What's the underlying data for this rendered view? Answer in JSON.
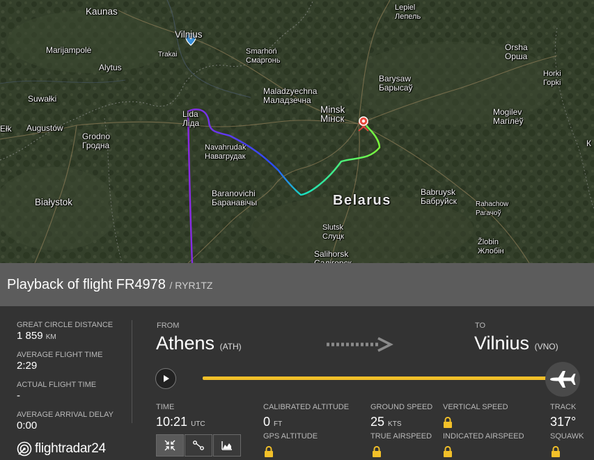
{
  "map": {
    "cities": [
      {
        "id": "kaunas",
        "label": "Kaunas"
      },
      {
        "id": "vilnius",
        "label": "Vilnius"
      },
      {
        "id": "trakai",
        "label": "Trakai"
      },
      {
        "id": "marijampole",
        "label": "Marijampolė"
      },
      {
        "id": "alytus",
        "label": "Alytus"
      },
      {
        "id": "smarhon",
        "label": "Smarhoń\nСмаргонь"
      },
      {
        "id": "lepiel",
        "label": "Lepiel\nЛепель"
      },
      {
        "id": "orsha",
        "label": "Orsha\nОрша"
      },
      {
        "id": "barysaw",
        "label": "Barysaw\nБарысаў"
      },
      {
        "id": "horki",
        "label": "Horki\nГорki"
      },
      {
        "id": "maladzyechna",
        "label": "Maladzyechna\nМаладзечна"
      },
      {
        "id": "minsk",
        "label": "Minsk\nМінск"
      },
      {
        "id": "mogilev",
        "label": "Mogilev\nМагілёў"
      },
      {
        "id": "suwalki",
        "label": "Suwałki"
      },
      {
        "id": "elk",
        "label": "Ełk"
      },
      {
        "id": "augustow",
        "label": "Augustów"
      },
      {
        "id": "grodno",
        "label": "Grodno\nГродна"
      },
      {
        "id": "lida",
        "label": "Lida\nЛіда"
      },
      {
        "id": "navahrudak",
        "label": "Navahrudak\nНавагрудак"
      },
      {
        "id": "baranovichi",
        "label": "Baranovichi\nБаранавічы"
      },
      {
        "id": "bialystok",
        "label": "Białystok"
      },
      {
        "id": "belarus",
        "label": "Belarus"
      },
      {
        "id": "babruysk",
        "label": "Babruysk\nБабруйск"
      },
      {
        "id": "rahachow",
        "label": "Rahachow\nРагачоў"
      },
      {
        "id": "slutsk",
        "label": "Slutsk\nСлуцк"
      },
      {
        "id": "salihorsk",
        "label": "Salihorsk\nСалігорск"
      },
      {
        "id": "zlobin",
        "label": "Žlobin\nЖлобін"
      },
      {
        "id": "edge-right",
        "label": "К"
      }
    ]
  },
  "header": {
    "title": "Playback of flight FR4978",
    "callsign": "/ RYR1TZ"
  },
  "stats": {
    "great_circle_label": "GREAT CIRCLE DISTANCE",
    "great_circle_value": "1 859",
    "great_circle_unit": "KM",
    "avg_flight_time_label": "AVERAGE FLIGHT TIME",
    "avg_flight_time_value": "2:29",
    "actual_flight_time_label": "ACTUAL FLIGHT TIME",
    "actual_flight_time_value": "-",
    "avg_arrival_delay_label": "AVERAGE ARRIVAL DELAY",
    "avg_arrival_delay_value": "0:00"
  },
  "brand": {
    "logo_text": "flightradar24"
  },
  "route": {
    "from_label": "FROM",
    "from_city": "Athens",
    "from_code": "(ATH)",
    "to_label": "TO",
    "to_city": "Vilnius",
    "to_code": "(VNO)"
  },
  "playback": {
    "progress": 1.0
  },
  "details": {
    "time_label": "TIME",
    "time_value": "10:21",
    "time_unit": "UTC",
    "cal_alt_label": "CALIBRATED ALTITUDE",
    "cal_alt_value": "0",
    "cal_alt_unit": "FT",
    "gps_alt_label": "GPS ALTITUDE",
    "ground_speed_label": "GROUND SPEED",
    "ground_speed_value": "25",
    "ground_speed_unit": "KTS",
    "true_airspeed_label": "TRUE AIRSPEED",
    "vertical_speed_label": "VERTICAL SPEED",
    "indicated_airspeed_label": "INDICATED AIRSPEED",
    "track_label": "TRACK",
    "track_value": "317°",
    "squawk_label": "SQUAWK"
  },
  "colors": {
    "accent": "#f2c029",
    "title_bar": "#5c5c5c",
    "panel": "#333333",
    "path_start": "#8a2be2",
    "path_end": "#7cff3a"
  }
}
